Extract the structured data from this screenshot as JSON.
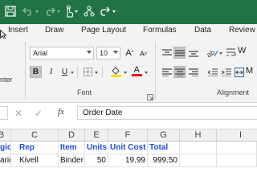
{
  "ribbon_tabs": [
    "Insert",
    "Draw",
    "Page Layout",
    "Formulas",
    "Data",
    "Review"
  ],
  "clipboard_fragment": "inter",
  "font": {
    "name": "Arial",
    "size": "10",
    "group_label": "Font"
  },
  "alignment": {
    "group_label": "Alignment",
    "wrap_fragment": "W",
    "merge_fragment": "M"
  },
  "formula_bar": {
    "fx": "fx",
    "content": "Order Date"
  },
  "columns": [
    "B",
    "C",
    "D",
    "E",
    "F",
    "G",
    "H",
    "I"
  ],
  "header_row": [
    "gion",
    "Rep",
    "Item",
    "Units",
    "Unit Cost",
    "Total",
    "",
    ""
  ],
  "data_row": [
    "ario",
    "Kivell",
    "Binder",
    "50",
    "19.99",
    "999.50",
    "",
    ""
  ],
  "colors": {
    "title_bar": "#217346",
    "header_text": "#1f4ed8",
    "fill_yellow": "#ffd800",
    "font_red": "#e81123"
  }
}
